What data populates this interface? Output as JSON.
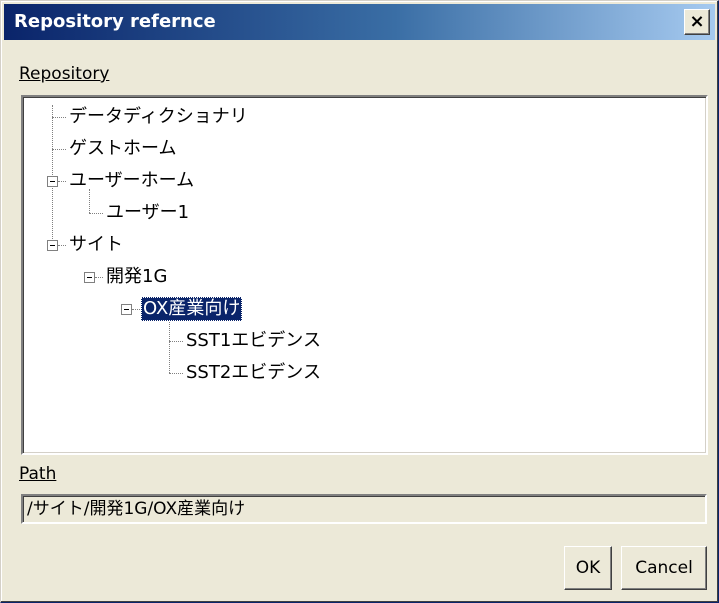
{
  "window": {
    "title": "Repository refernce",
    "close_glyph": "×"
  },
  "repository": {
    "label": "Repository",
    "tree": [
      {
        "label": "データディクショナリ",
        "level": 0,
        "expander": false,
        "selected": false
      },
      {
        "label": "ゲストホーム",
        "level": 0,
        "expander": false,
        "selected": false
      },
      {
        "label": "ユーザーホーム",
        "level": 0,
        "expander": true,
        "selected": false
      },
      {
        "label": "ユーザー1",
        "level": 1,
        "expander": false,
        "selected": false
      },
      {
        "label": "サイト",
        "level": 0,
        "expander": true,
        "selected": false
      },
      {
        "label": "開発1G",
        "level": 1,
        "expander": true,
        "selected": false
      },
      {
        "label": "OX産業向け",
        "level": 2,
        "expander": true,
        "selected": true
      },
      {
        "label": "SST1エビデンス",
        "level": 3,
        "expander": false,
        "selected": false
      },
      {
        "label": "SST2エビデンス",
        "level": 3,
        "expander": false,
        "selected": false
      }
    ]
  },
  "path": {
    "label": "Path",
    "value": "/サイト/開発1G/OX産業向け"
  },
  "buttons": {
    "ok": "OK",
    "cancel": "Cancel"
  },
  "colors": {
    "title_bar_start": "#0a246a",
    "title_bar_end": "#a6caf0",
    "selection": "#0a246a",
    "dialog_bg": "#ece9d8"
  }
}
